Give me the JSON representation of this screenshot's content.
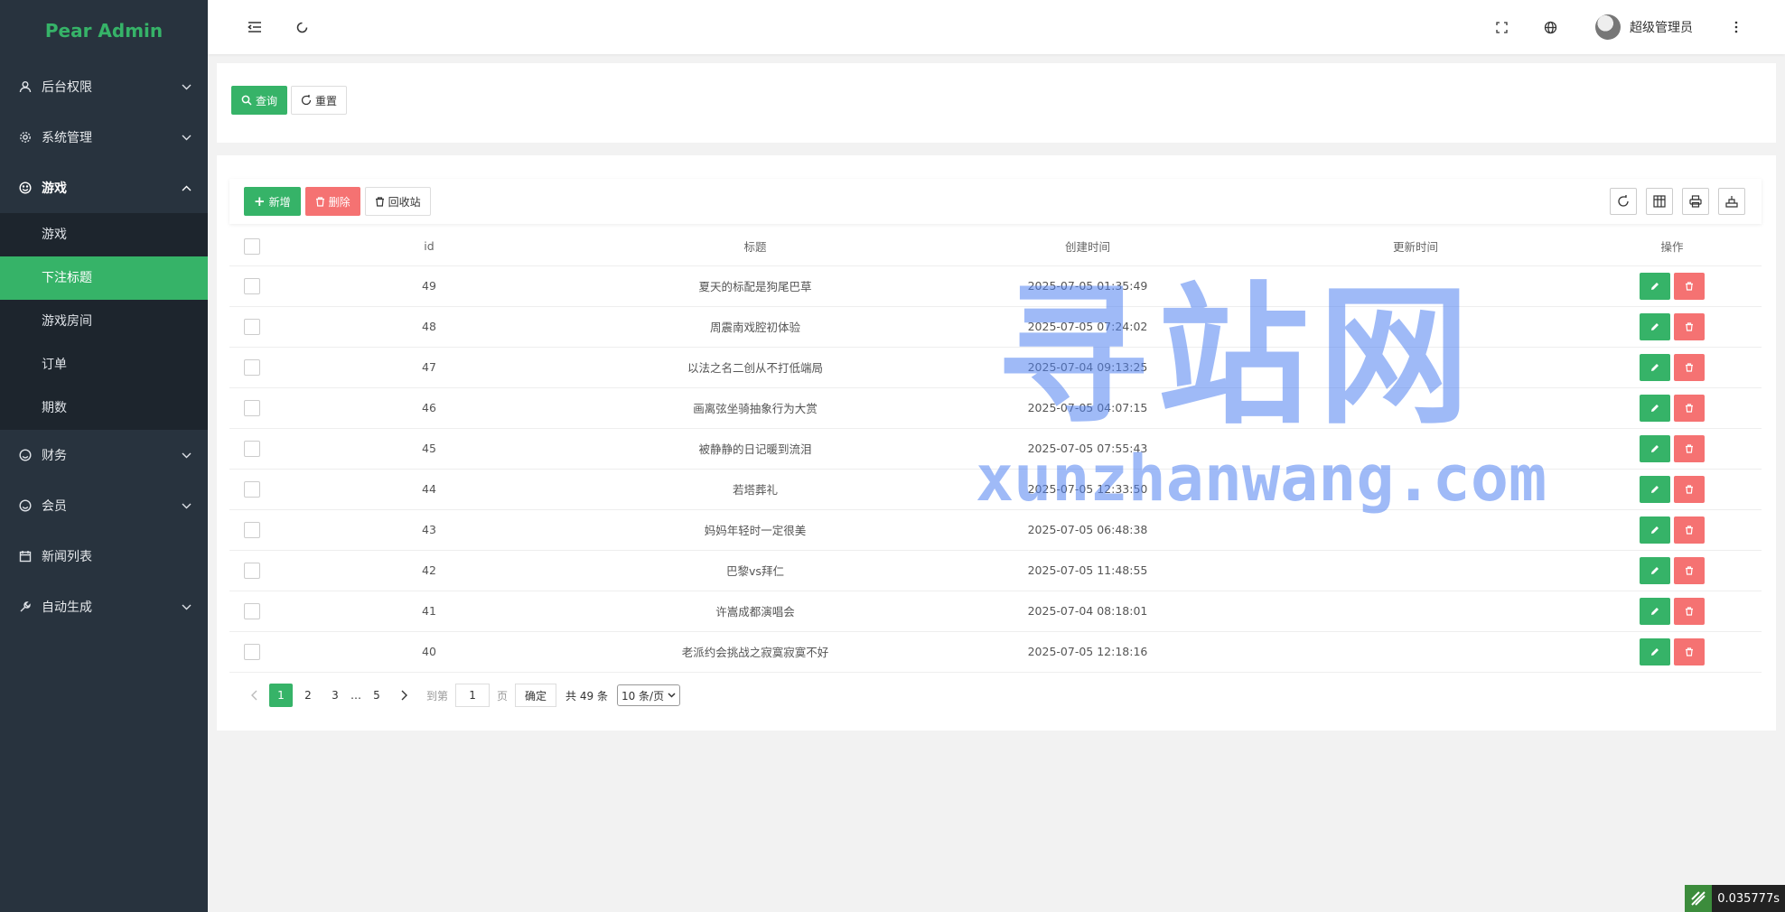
{
  "brand": "Pear Admin",
  "sidebar": {
    "items": [
      {
        "label": "后台权限",
        "icon": "user-icon"
      },
      {
        "label": "系统管理",
        "icon": "gear-icon"
      },
      {
        "label": "游戏",
        "icon": "smile-icon"
      },
      {
        "label": "财务",
        "icon": "smile-icon"
      },
      {
        "label": "会员",
        "icon": "smile-icon"
      },
      {
        "label": "新闻列表",
        "icon": "calendar-icon"
      },
      {
        "label": "自动生成",
        "icon": "tool-icon"
      }
    ],
    "sub_items": [
      "游戏",
      "下注标题",
      "游戏房间",
      "订单",
      "期数"
    ],
    "active_sub": "下注标题"
  },
  "topbar": {
    "user_name": "超级管理员"
  },
  "search": {
    "query_label": "查询",
    "reset_label": "重置"
  },
  "toolbar": {
    "add_label": "新增",
    "delete_label": "删除",
    "recycle_label": "回收站"
  },
  "table": {
    "columns": [
      "id",
      "标题",
      "创建时间",
      "更新时间",
      "操作"
    ],
    "rows": [
      {
        "id": "49",
        "title": "夏天的标配是狗尾巴草",
        "created": "2025-07-05 01:35:49",
        "updated": ""
      },
      {
        "id": "48",
        "title": "周震南戏腔初体验",
        "created": "2025-07-05 07:24:02",
        "updated": ""
      },
      {
        "id": "47",
        "title": "以法之名二创从不打低端局",
        "created": "2025-07-04 09:13:25",
        "updated": ""
      },
      {
        "id": "46",
        "title": "画离弦坐骑抽象行为大赏",
        "created": "2025-07-05 04:07:15",
        "updated": ""
      },
      {
        "id": "45",
        "title": "被静静的日记暖到流泪",
        "created": "2025-07-05 07:55:43",
        "updated": ""
      },
      {
        "id": "44",
        "title": "若塔葬礼",
        "created": "2025-07-05 12:33:50",
        "updated": ""
      },
      {
        "id": "43",
        "title": "妈妈年轻时一定很美",
        "created": "2025-07-05 06:48:38",
        "updated": ""
      },
      {
        "id": "42",
        "title": "巴黎vs拜仁",
        "created": "2025-07-05 11:48:55",
        "updated": ""
      },
      {
        "id": "41",
        "title": "许嵩成都演唱会",
        "created": "2025-07-04 08:18:01",
        "updated": ""
      },
      {
        "id": "40",
        "title": "老派约会挑战之寂寞寂寞不好",
        "created": "2025-07-05 12:18:16",
        "updated": ""
      }
    ]
  },
  "pager": {
    "pages": [
      "1",
      "2",
      "3",
      "…",
      "5"
    ],
    "current": "1",
    "goto_prefix": "到第",
    "goto_value": "1",
    "goto_suffix": "页",
    "confirm": "确定",
    "total": "共 49 条",
    "page_size": "10 条/页"
  },
  "watermark": {
    "cn": "寻站网",
    "en": "xunzhanwang.com"
  },
  "timer": "0.035777s",
  "colors": {
    "primary": "#36b368",
    "danger": "#f57272",
    "sidebar": "#28333e"
  }
}
